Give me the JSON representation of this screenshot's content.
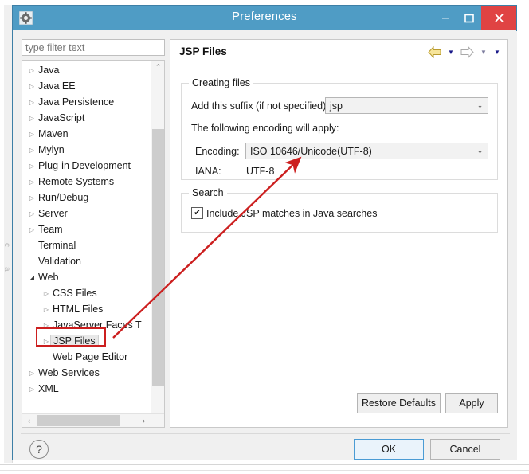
{
  "window": {
    "title": "Preferences",
    "icon": "gear-icon",
    "controls": {
      "minimize": "–",
      "maximize": "❐",
      "close": "✕"
    },
    "titlebar_color": "#4f9cc5",
    "close_color": "#e04343"
  },
  "sidebar": {
    "filter": {
      "value": "",
      "placeholder": "type filter text"
    },
    "items": [
      {
        "label": "Java",
        "indent": 0,
        "twisty": "collapsed",
        "selected": false
      },
      {
        "label": "Java EE",
        "indent": 0,
        "twisty": "collapsed",
        "selected": false
      },
      {
        "label": "Java Persistence",
        "indent": 0,
        "twisty": "collapsed",
        "selected": false
      },
      {
        "label": "JavaScript",
        "indent": 0,
        "twisty": "collapsed",
        "selected": false
      },
      {
        "label": "Maven",
        "indent": 0,
        "twisty": "collapsed",
        "selected": false
      },
      {
        "label": "Mylyn",
        "indent": 0,
        "twisty": "collapsed",
        "selected": false
      },
      {
        "label": "Plug-in Development",
        "indent": 0,
        "twisty": "collapsed",
        "selected": false
      },
      {
        "label": "Remote Systems",
        "indent": 0,
        "twisty": "collapsed",
        "selected": false
      },
      {
        "label": "Run/Debug",
        "indent": 0,
        "twisty": "collapsed",
        "selected": false
      },
      {
        "label": "Server",
        "indent": 0,
        "twisty": "collapsed",
        "selected": false
      },
      {
        "label": "Team",
        "indent": 0,
        "twisty": "collapsed",
        "selected": false
      },
      {
        "label": "Terminal",
        "indent": 0,
        "twisty": "none",
        "selected": false
      },
      {
        "label": "Validation",
        "indent": 0,
        "twisty": "none",
        "selected": false
      },
      {
        "label": "Web",
        "indent": 0,
        "twisty": "expanded",
        "selected": false
      },
      {
        "label": "CSS Files",
        "indent": 1,
        "twisty": "collapsed",
        "selected": false
      },
      {
        "label": "HTML Files",
        "indent": 1,
        "twisty": "collapsed",
        "selected": false
      },
      {
        "label": "JavaServer Faces T",
        "indent": 1,
        "twisty": "collapsed",
        "selected": false
      },
      {
        "label": "JSP Files",
        "indent": 1,
        "twisty": "collapsed",
        "selected": true
      },
      {
        "label": "Web Page Editor",
        "indent": 1,
        "twisty": "none",
        "selected": false
      },
      {
        "label": "Web Services",
        "indent": 0,
        "twisty": "collapsed",
        "selected": false
      },
      {
        "label": "XML",
        "indent": 0,
        "twisty": "collapsed",
        "selected": false
      }
    ],
    "scroll": {
      "up_arrow": "⌃",
      "down_arrow": "⌄",
      "left_arrow": "‹",
      "right_arrow": "›"
    }
  },
  "content": {
    "title": "JSP Files",
    "nav": {
      "back_icon": "back-arrow-icon",
      "back_chevron": "▼",
      "forward_icon": "forward-arrow-icon",
      "forward_chevron": "▼",
      "menu_chevron": "▼"
    },
    "creating_files": {
      "group_label": "Creating files",
      "suffix_label": "Add this suffix (if not specified):",
      "suffix_value": "jsp",
      "encoding_note": "The following encoding will apply:",
      "encoding_label": "Encoding:",
      "encoding_value": "ISO 10646/Unicode(UTF-8)",
      "iana_label": "IANA:",
      "iana_value": "UTF-8",
      "dropdown_arrow": "⌄"
    },
    "search": {
      "group_label": "Search",
      "checkbox_label": "Include JSP matches in Java searches",
      "checkbox_checked": true,
      "check_glyph": "✔"
    },
    "buttons": {
      "restore_defaults": "Restore Defaults",
      "apply": "Apply"
    }
  },
  "footer": {
    "help": "?",
    "ok": "OK",
    "cancel": "Cancel"
  },
  "annotations": {
    "highlight_color": "#cc1f1f",
    "arrow_from": "JSP Files tree item",
    "arrow_to": "Encoding dropdown"
  },
  "background": {
    "ghost_label_1": "c",
    "ghost_label_2": "a"
  }
}
